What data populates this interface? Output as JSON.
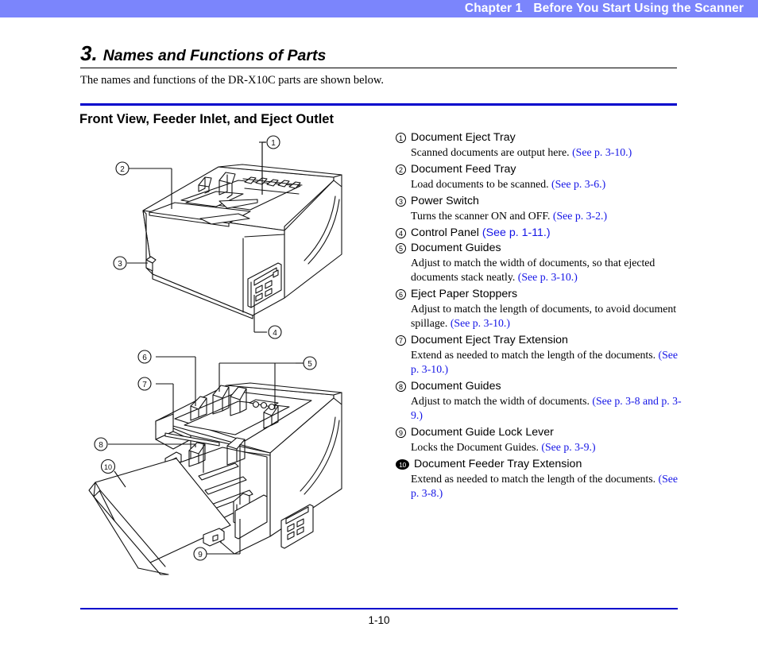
{
  "header": {
    "chapter": "Chapter 1",
    "title": "Before You Start Using the Scanner",
    "band_color": "#7b85fc"
  },
  "section": {
    "number": "3.",
    "title": "Names and Functions of Parts",
    "intro": "The names and functions of the DR-X10C parts are shown below.",
    "subsection": "Front View, Feeder Inlet, and Eject Outlet",
    "rule_color": "#0000cc"
  },
  "figures": {
    "front": {
      "name": "front-view-scanner-illustration",
      "callouts": [
        "1",
        "2",
        "3",
        "4"
      ]
    },
    "feeder": {
      "name": "feeder-inlet-scanner-illustration",
      "callouts": [
        "5",
        "6",
        "7",
        "8",
        "9",
        "10"
      ]
    }
  },
  "legend": {
    "link_color": "#1414e6",
    "items": [
      {
        "num": "1",
        "title": "Document Eject Tray",
        "desc": "Scanned documents are output here. ",
        "link": "(See p. 3-10.)"
      },
      {
        "num": "2",
        "title": "Document Feed Tray",
        "desc": "Load documents to be scanned. ",
        "link": "(See p. 3-6.)"
      },
      {
        "num": "3",
        "title": "Power Switch",
        "desc": "Turns the scanner ON and OFF. ",
        "link": "(See p. 3-2.)"
      },
      {
        "num": "4",
        "title": "Control Panel ",
        "title_link": "(See p. 1-11.)",
        "desc": "",
        "link": ""
      },
      {
        "num": "5",
        "title": "Document Guides",
        "desc": "Adjust to match the width of documents, so that ejected documents stack neatly. ",
        "link": "(See p. 3-10.)"
      },
      {
        "num": "6",
        "title": "Eject Paper Stoppers",
        "desc": "Adjust to match the length of documents, to avoid document spillage. ",
        "link": "(See p. 3-10.)"
      },
      {
        "num": "7",
        "title": "Document Eject Tray Extension",
        "desc": "Extend as needed to match the length of the documents. ",
        "link": "(See p. 3-10.)"
      },
      {
        "num": "8",
        "title": "Document Guides",
        "desc": "Adjust to match the width of documents. ",
        "link": "(See p. 3-8 and p. 3-9.)"
      },
      {
        "num": "9",
        "title": "Document Guide Lock Lever",
        "desc": "Locks the Document Guides. ",
        "link": "(See p. 3-9.)"
      },
      {
        "num": "10",
        "title": "Document Feeder Tray Extension",
        "desc": "Extend as needed to match the length of the documents. ",
        "link": "(See p. 3-8.)"
      }
    ]
  },
  "footer": {
    "page": "1-10",
    "rule_color": "#0000cc"
  }
}
